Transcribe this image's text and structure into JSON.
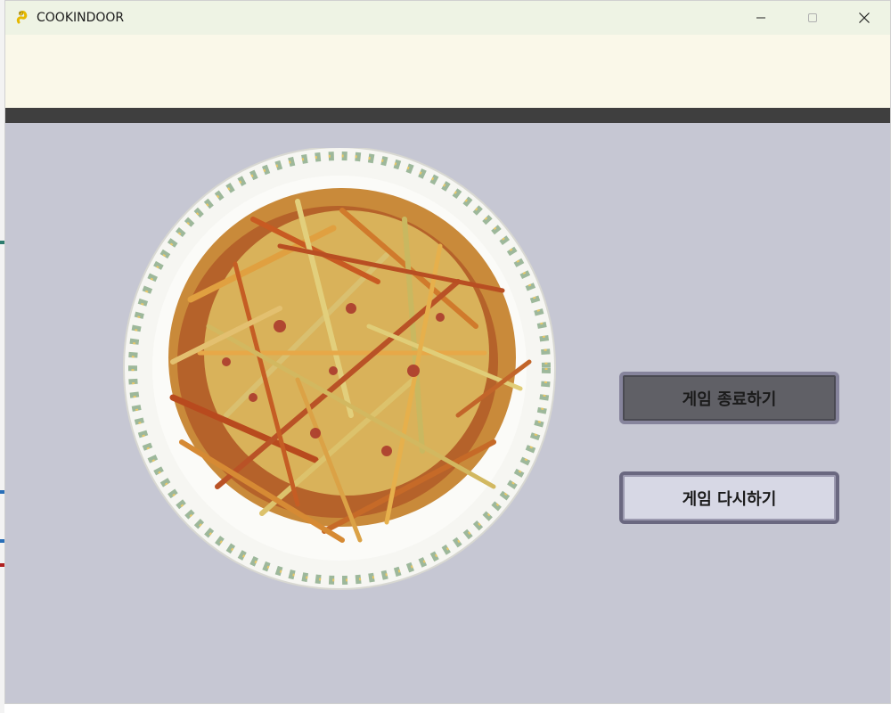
{
  "window": {
    "title": "COOKINDOOR",
    "icon": "pygame-snake-icon",
    "controls": [
      "minimize-icon",
      "maximize-icon",
      "close-icon"
    ]
  },
  "main": {
    "dish_image": "hash-brown-plate",
    "buttons": {
      "quit_label": "게임 종료하기",
      "retry_label": "게임 다시하기"
    }
  },
  "colors": {
    "background": "#c6c7d3",
    "header_band": "#faf8e9",
    "dark_strip": "#3f3f3f",
    "quit_button": "#606066",
    "retry_button": "#d7d8e5"
  }
}
